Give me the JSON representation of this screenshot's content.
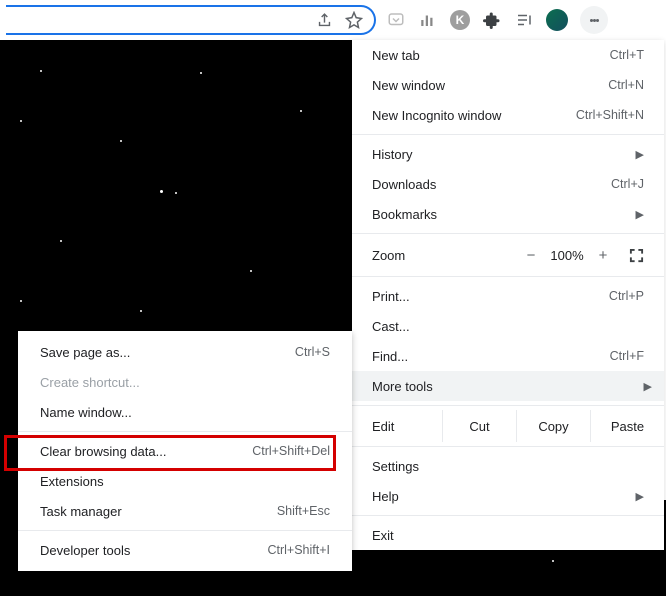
{
  "toolbar": {
    "icons": {
      "share": "share-icon",
      "star": "star-icon",
      "pocket": "pocket-icon",
      "analytics": "chart-icon",
      "k": "K",
      "puzzle": "puzzle-icon",
      "reading": "reading-list-icon"
    }
  },
  "menu": {
    "new_tab": {
      "label": "New tab",
      "shortcut": "Ctrl+T"
    },
    "new_window": {
      "label": "New window",
      "shortcut": "Ctrl+N"
    },
    "new_incognito": {
      "label": "New Incognito window",
      "shortcut": "Ctrl+Shift+N"
    },
    "history": {
      "label": "History"
    },
    "downloads": {
      "label": "Downloads",
      "shortcut": "Ctrl+J"
    },
    "bookmarks": {
      "label": "Bookmarks"
    },
    "zoom": {
      "label": "Zoom",
      "minus": "−",
      "pct": "100%",
      "plus": "+"
    },
    "print": {
      "label": "Print...",
      "shortcut": "Ctrl+P"
    },
    "cast": {
      "label": "Cast..."
    },
    "find": {
      "label": "Find...",
      "shortcut": "Ctrl+F"
    },
    "more_tools": {
      "label": "More tools"
    },
    "edit": {
      "label": "Edit",
      "cut": "Cut",
      "copy": "Copy",
      "paste": "Paste"
    },
    "settings": {
      "label": "Settings"
    },
    "help": {
      "label": "Help"
    },
    "exit": {
      "label": "Exit"
    }
  },
  "submenu": {
    "save_page": {
      "label": "Save page as...",
      "shortcut": "Ctrl+S"
    },
    "create_shortcut": {
      "label": "Create shortcut..."
    },
    "name_window": {
      "label": "Name window..."
    },
    "clear_data": {
      "label": "Clear browsing data...",
      "shortcut": "Ctrl+Shift+Del"
    },
    "extensions": {
      "label": "Extensions"
    },
    "task_manager": {
      "label": "Task manager",
      "shortcut": "Shift+Esc"
    },
    "dev_tools": {
      "label": "Developer tools",
      "shortcut": "Ctrl+Shift+I"
    }
  }
}
